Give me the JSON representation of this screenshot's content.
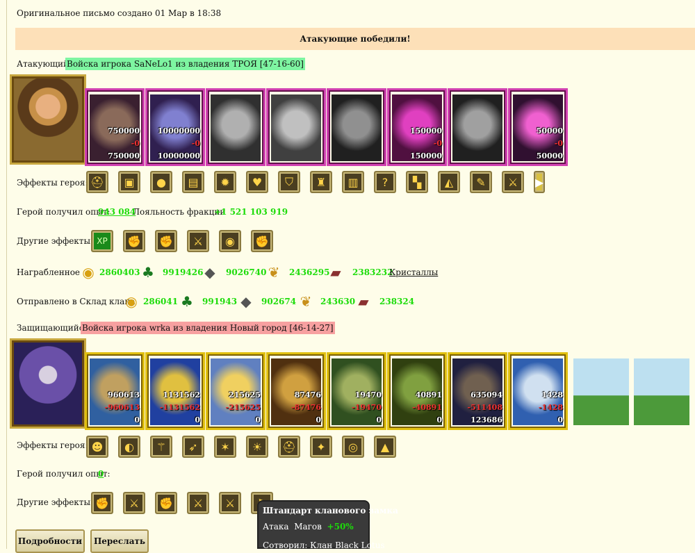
{
  "header": {
    "created": "Оригинальное письмо создано 01 Мар в 18:38"
  },
  "banner": "Атакующие победили!",
  "attacker": {
    "label": "Атакующий",
    "army": "Войска игрока SaNeLo1 из владения ТРОЯ [47-16-60]",
    "troops": [
      {
        "count": "750000",
        "loss": "-0",
        "left": "750000"
      },
      {
        "count": "10000000",
        "loss": "-0",
        "left": "10000000"
      },
      {
        "count": "",
        "loss": "",
        "left": ""
      },
      {
        "count": "",
        "loss": "",
        "left": ""
      },
      {
        "count": "",
        "loss": "",
        "left": ""
      },
      {
        "count": "150000",
        "loss": "-0",
        "left": "150000"
      },
      {
        "count": "",
        "loss": "",
        "left": ""
      },
      {
        "count": "50000",
        "loss": "-0",
        "left": "50000"
      }
    ],
    "effects_label": "Эффекты героя:",
    "effects_icons": [
      "helmet-icon",
      "armor-icon",
      "orb-icon",
      "chest-icon",
      "fire-icon",
      "heart-icon",
      "shield-icon",
      "totem-icon",
      "vest-icon",
      "question-icon",
      "boots-icon",
      "cloak-icon",
      "scroll-icon",
      "sword-icon",
      "arrow-right-icon"
    ],
    "exp_label": "Герой получил опыт:",
    "exp_value": "943 084",
    "loyalty_label": "Лояльность фракции",
    "loyalty_value": "+1 521 103 919",
    "other_label": "Другие эффекты:",
    "other_icons": [
      "xp-icon",
      "attack-fist-icon",
      "attack-fist-icon",
      "sword-icon",
      "gold-pouch-icon",
      "attack-fist-icon"
    ],
    "loot_label": "Награбленное",
    "loot": [
      {
        "icon": "gold-icon",
        "value": "2860403"
      },
      {
        "icon": "wood-icon",
        "value": "9919426"
      },
      {
        "icon": "ore-icon",
        "value": "9026740"
      },
      {
        "icon": "grain-icon",
        "value": "2436295"
      },
      {
        "icon": "stone-icon",
        "value": "2383232"
      }
    ],
    "crystals_link": "Кристаллы",
    "clan_label": "Отправлено в Склад клана",
    "clan": [
      {
        "icon": "gold-icon",
        "value": "286041"
      },
      {
        "icon": "wood-icon",
        "value": "991943"
      },
      {
        "icon": "ore-icon",
        "value": "902674"
      },
      {
        "icon": "grain-icon",
        "value": "243630"
      },
      {
        "icon": "stone-icon",
        "value": "238324"
      }
    ]
  },
  "defender": {
    "label": "Защищающийся",
    "army": "Войска игрока wrka из владения Новый город [46-14-27]",
    "troops": [
      {
        "count": "960613",
        "loss": "-960613",
        "left": "0"
      },
      {
        "count": "1131562",
        "loss": "-1131562",
        "left": "0"
      },
      {
        "count": "215625",
        "loss": "-215625",
        "left": "0"
      },
      {
        "count": "87476",
        "loss": "-87476",
        "left": "0"
      },
      {
        "count": "19470",
        "loss": "-19470",
        "left": "0"
      },
      {
        "count": "40891",
        "loss": "-40891",
        "left": "0"
      },
      {
        "count": "635094",
        "loss": "-511408",
        "left": "123686"
      },
      {
        "count": "1428",
        "loss": "-1428",
        "left": "0"
      }
    ],
    "effects_label": "Эффекты героя:",
    "effects_icons": [
      "mask-icon",
      "mask-shield-icon",
      "staff-icon",
      "bow-icon",
      "star-icon",
      "sun-icon",
      "helmet-icon",
      "wand-icon",
      "round-shield-icon",
      "cape-icon"
    ],
    "exp_label": "Герой получил опыт:",
    "exp_value": "0",
    "other_label": "Другие эффекты:",
    "other_icons": [
      "attack-fist-icon",
      "sword-icon",
      "attack-fist-icon",
      "sword-icon",
      "sword-icon",
      "banner-icon"
    ]
  },
  "tooltip": {
    "title": "Штандарт кланового замка",
    "line_label": "Атака",
    "line_target": "Магов",
    "line_value": "+50%",
    "footer": "Сотворил: Клан Black Lotus"
  },
  "buttons": {
    "details": "Подробности",
    "forward": "Переслать"
  }
}
